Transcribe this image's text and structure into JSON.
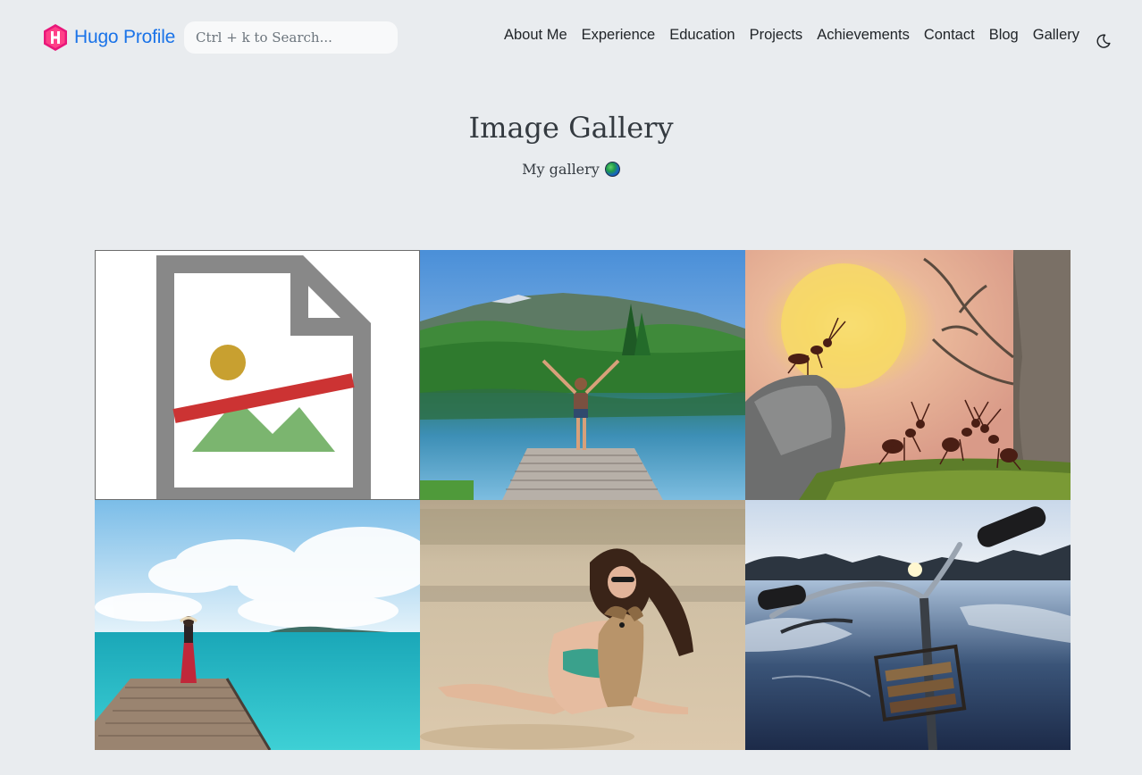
{
  "brand": {
    "name": "Hugo Profile",
    "logo_letter": "H"
  },
  "search": {
    "placeholder": "Ctrl + k to Search..."
  },
  "nav": {
    "links": [
      "About Me",
      "Experience",
      "Education",
      "Projects",
      "Achievements",
      "Contact",
      "Blog",
      "Gallery"
    ]
  },
  "header": {
    "title": "Image Gallery",
    "subtitle": "My gallery"
  },
  "gallery": {
    "images": [
      {
        "description": "broken image",
        "status": "failed-to-load"
      },
      {
        "description": "woman on dock at mountain lake"
      },
      {
        "description": "ants at sunset"
      },
      {
        "description": "woman on pier by turquoise sea"
      },
      {
        "description": "woman hugging dog on beach"
      },
      {
        "description": "bicycle handlebars frozen lake"
      }
    ]
  },
  "colors": {
    "background": "#e9ecef",
    "brand": "#1a73e8",
    "logo": "#e8177a"
  }
}
